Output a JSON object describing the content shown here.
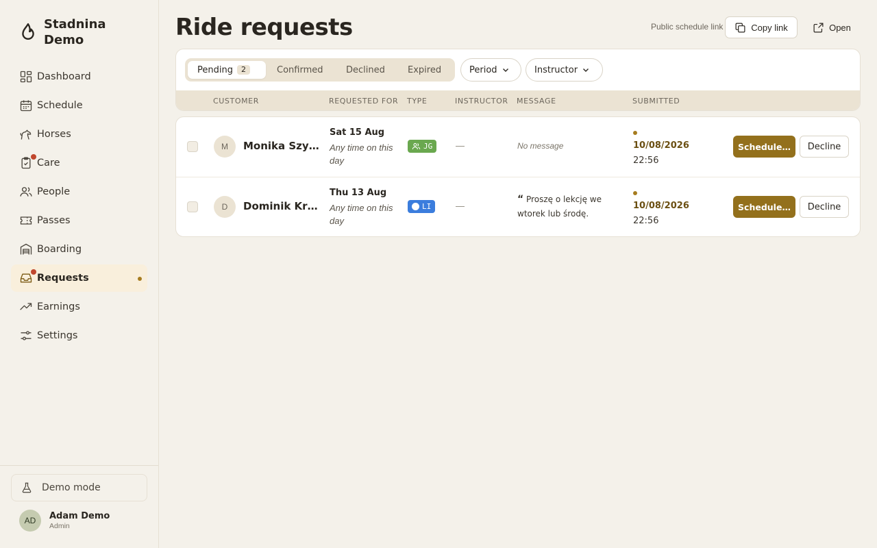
{
  "brand": {
    "name_line1": "Stadnina",
    "name_line2": "Demo",
    "icon": "flame-icon"
  },
  "sidebar": {
    "items": [
      {
        "label": "Dashboard",
        "icon": "dashboard-icon"
      },
      {
        "label": "Schedule",
        "icon": "calendar-icon"
      },
      {
        "label": "Horses",
        "icon": "horse-icon"
      },
      {
        "label": "Care",
        "icon": "clipboard-check-icon",
        "badge": true
      },
      {
        "label": "People",
        "icon": "people-icon"
      },
      {
        "label": "Passes",
        "icon": "ticket-icon"
      },
      {
        "label": "Boarding",
        "icon": "warehouse-icon"
      },
      {
        "label": "Requests",
        "icon": "inbox-icon",
        "badge": true,
        "active": true
      },
      {
        "label": "Earnings",
        "icon": "trend-up-icon"
      },
      {
        "label": "Settings",
        "icon": "sliders-icon"
      }
    ],
    "demo_mode": "Demo mode",
    "user": {
      "initials": "AD",
      "name": "Adam Demo",
      "role": "Admin"
    }
  },
  "header": {
    "title": "Ride requests",
    "public_link_label": "Public schedule link",
    "copy_link": "Copy link",
    "open": "Open"
  },
  "filters": {
    "tabs": [
      {
        "label": "Pending",
        "count": "2",
        "active": true
      },
      {
        "label": "Confirmed"
      },
      {
        "label": "Declined"
      },
      {
        "label": "Expired"
      }
    ],
    "period": "Period",
    "instructor": "Instructor"
  },
  "table": {
    "columns": [
      "CUSTOMER",
      "REQUESTED FOR",
      "TYPE",
      "INSTRUCTOR",
      "MESSAGE",
      "SUBMITTED"
    ],
    "rows": [
      {
        "initial": "M",
        "customer": "Monika Szymańska",
        "date": "Sat 15 Aug",
        "time": "Any time on this day",
        "type": "JG",
        "type_color": "#6aa84f",
        "instructor": "—",
        "message": "No message",
        "submitted_date": "10/08/2026",
        "submitted_time": "22:56",
        "schedule": "Schedule…",
        "decline": "Decline"
      },
      {
        "initial": "D",
        "customer": "Dominik Krawczyk",
        "date": "Thu 13 Aug",
        "time": "Any time on this day",
        "type": "LI",
        "type_color": "#3b7ddd",
        "instructor": "—",
        "message_quote": "“",
        "message": "Proszę o lekcję we wtorek lub środę.",
        "submitted_date": "10/08/2026",
        "submitted_time": "22:56",
        "schedule": "Schedule…",
        "decline": "Decline"
      }
    ]
  },
  "colors": {
    "accent": "#93701c",
    "background": "#f4f1ea",
    "badge": "#c0472d"
  }
}
